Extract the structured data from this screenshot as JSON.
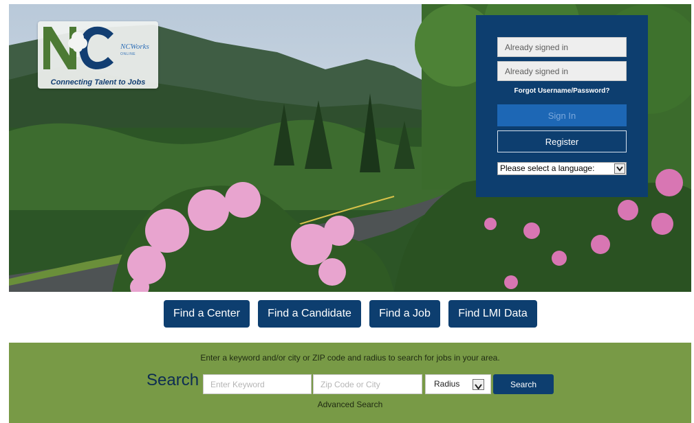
{
  "logo": {
    "brand": "NCWorks",
    "subbrand": "ONLINE",
    "tagline": "Connecting Talent to Jobs"
  },
  "login": {
    "username_value": "Already signed in",
    "password_value": "Already signed in",
    "forgot_label": "Forgot Username/Password?",
    "signin_label": "Sign In",
    "register_label": "Register",
    "language_selected": "Please select a language:"
  },
  "nav": {
    "find_center": "Find a Center",
    "find_candidate": "Find a Candidate",
    "find_job": "Find a Job",
    "find_lmi": "Find LMI Data"
  },
  "search": {
    "instructions": "Enter a keyword and/or city or ZIP code and radius to search for jobs in your area.",
    "heading": "Search",
    "keyword_placeholder": "Enter Keyword",
    "zip_placeholder": "Zip Code or City",
    "radius_selected": "Radius",
    "button_label": "Search",
    "advanced_label": "Advanced Search"
  },
  "colors": {
    "navy": "#0d3e6f",
    "signin_blue": "#1d67b5",
    "search_band_green": "#789a46",
    "logo_green": "#4c7a34",
    "logo_blue": "#123e72"
  },
  "icons": {
    "logo_tree": "tree-icon",
    "dropdown": "chevron-down-icon"
  }
}
